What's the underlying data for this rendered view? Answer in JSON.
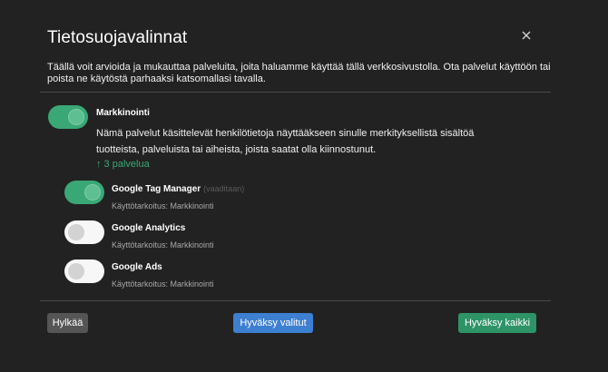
{
  "dialog": {
    "title": "Tietosuojavalinnat",
    "intro": "Täällä voit arvioida ja mukauttaa palveluita, joita haluamme käyttää tällä verkkosivustolla. Ota palvelut käyttöön tai poista ne käytöstä parhaaksi katsomallasi tavalla."
  },
  "category": {
    "name": "Markkinointi",
    "enabled": true,
    "description": "Nämä palvelut käsittelevät henkilötietoja näyttääkseen sinulle merkityksellistä sisältöä tuotteista, palveluista tai aiheista, joista saatat olla kiinnostunut.",
    "services_link": "↑ 3 palvelua"
  },
  "services": [
    {
      "name": "Google Tag Manager",
      "required_label": "(vaaditaan)",
      "purpose": "Käyttötarkoitus: Markkinointi",
      "enabled": true
    },
    {
      "name": "Google Analytics",
      "required_label": "",
      "purpose": "Käyttötarkoitus: Markkinointi",
      "enabled": false
    },
    {
      "name": "Google Ads",
      "required_label": "",
      "purpose": "Käyttötarkoitus: Markkinointi",
      "enabled": false
    }
  ],
  "buttons": {
    "decline": "Hylkää",
    "accept_selected": "Hyväksy valitut",
    "accept_all": "Hyväksy kaikki"
  },
  "icons": {
    "close": "close-icon"
  },
  "colors": {
    "background": "#222222",
    "toggle_on": "#3aa876",
    "toggle_off": "#f7f7f7",
    "link": "#3aa876",
    "accept_selected": "#3d7fd1",
    "accept_all": "#2e9468",
    "decline": "#555555"
  }
}
